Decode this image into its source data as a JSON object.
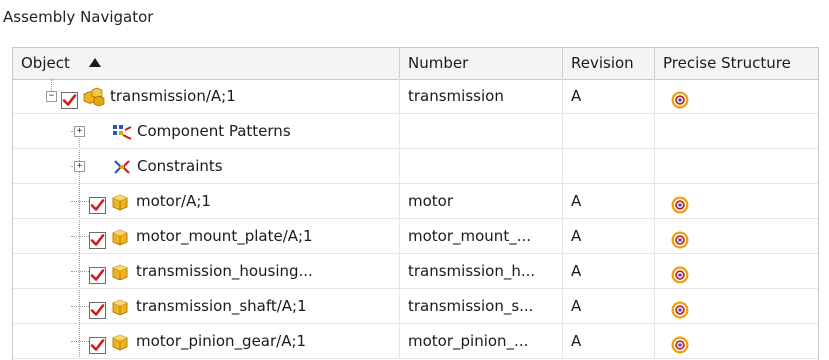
{
  "navigator": {
    "title": "Assembly Navigator",
    "columns": {
      "object": "Object",
      "number": "Number",
      "revision": "Revision",
      "precise_structure": "Precise Structure"
    },
    "rows": [
      {
        "label": "transmission/A;1",
        "number": "transmission",
        "revision": "A",
        "precise": true,
        "icon": "assembly-icon",
        "checked": true,
        "expander": "-"
      },
      {
        "label": "Component Patterns",
        "number": "",
        "revision": "",
        "precise": false,
        "icon": "component-patterns-icon",
        "checked": false,
        "expander": "+"
      },
      {
        "label": "Constraints",
        "number": "",
        "revision": "",
        "precise": false,
        "icon": "constraints-icon",
        "checked": false,
        "expander": "+"
      },
      {
        "label": "motor/A;1",
        "number": "motor",
        "revision": "A",
        "precise": true,
        "icon": "part-icon",
        "checked": true
      },
      {
        "label": "motor_mount_plate/A;1",
        "number": "motor_mount_...",
        "revision": "A",
        "precise": true,
        "icon": "part-icon",
        "checked": true
      },
      {
        "label": "transmission_housing...",
        "number": "transmission_h...",
        "revision": "A",
        "precise": true,
        "icon": "part-icon",
        "checked": true
      },
      {
        "label": "transmission_shaft/A;1",
        "number": "transmission_s...",
        "revision": "A",
        "precise": true,
        "icon": "part-icon",
        "checked": true
      },
      {
        "label": "motor_pinion_gear/A;1",
        "number": "motor_pinion_...",
        "revision": "A",
        "precise": true,
        "icon": "part-icon",
        "checked": true
      }
    ],
    "colors": {
      "check": "#d21a1a",
      "part": "#f2b21b",
      "target_outer": "#e8a20f",
      "target_mid": "#d4231a",
      "target_inner": "#2b61d6"
    }
  }
}
